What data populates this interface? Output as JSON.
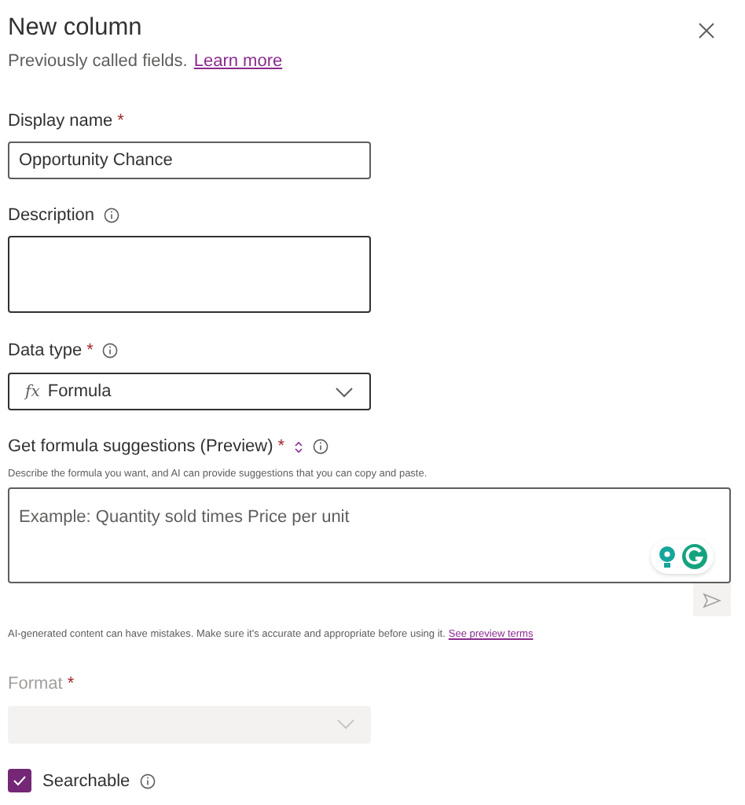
{
  "panel": {
    "title": "New column",
    "subtitle": "Previously called fields.",
    "subtitle_link": "Learn more"
  },
  "display_name": {
    "label": "Display name",
    "required_mark": "*",
    "value": "Opportunity Chance"
  },
  "description": {
    "label": "Description",
    "info": true
  },
  "data_type": {
    "label": "Data type",
    "required_mark": "*",
    "info": true,
    "prefix": "fx",
    "value": "Formula"
  },
  "formula_suggestions": {
    "label": "Get formula suggestions (Preview)",
    "required_mark": "*",
    "info": true,
    "help": "Describe the formula you want, and AI can provide suggestions that you can copy and paste.",
    "placeholder": "Example: Quantity sold times Price per unit",
    "disclaimer": "AI-generated content can have mistakes. Make sure it's accurate and appropriate before using it.",
    "disclaimer_link": "See preview terms"
  },
  "format": {
    "label": "Format",
    "required_mark": "*",
    "disabled": true
  },
  "searchable": {
    "label": "Searchable",
    "checked": true,
    "info": true
  }
}
